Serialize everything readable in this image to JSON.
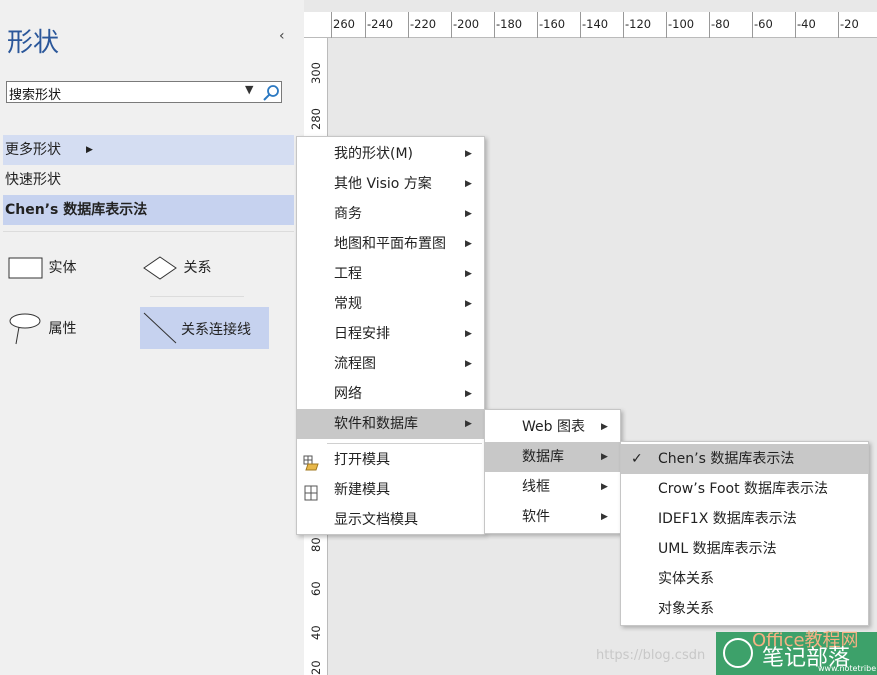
{
  "pane": {
    "title": "形状",
    "collapse_glyph": "‹",
    "search_value": "搜索形状",
    "rows": {
      "more": "更多形状",
      "quick": "快速形状",
      "chen": "Chen’s 数据库表示法"
    },
    "stencils": {
      "entity": "实体",
      "relation": "关系",
      "attribute": "属性",
      "connector": "关系连接线"
    }
  },
  "ruler": {
    "top": [
      "260",
      "-240",
      "-220",
      "-200",
      "-180",
      "-160",
      "-140",
      "-120",
      "-100",
      "-80",
      "-60",
      "-40",
      "-20"
    ],
    "left": [
      "300",
      "280",
      "80",
      "60",
      "40",
      "20"
    ]
  },
  "menu1": {
    "items": [
      "我的形状(M)",
      "其他 Visio 方案",
      "商务",
      "地图和平面布置图",
      "工程",
      "常规",
      "日程安排",
      "流程图",
      "网络",
      "软件和数据库"
    ],
    "actions": [
      "打开模具",
      "新建模具",
      "显示文档模具"
    ]
  },
  "menu2": {
    "items": [
      "Web 图表",
      "数据库",
      "线框",
      "软件"
    ]
  },
  "menu3": {
    "items": [
      "Chen’s 数据库表示法",
      "Crow’s Foot 数据库表示法",
      "IDEF1X 数据库表示法",
      "UML 数据库表示法",
      "实体关系",
      "对象关系"
    ]
  },
  "watermark": {
    "url": "https://blog.csdn",
    "brand": "笔记部落",
    "office": "Office教程网",
    "site": "www.notetribe.com"
  },
  "colors": {
    "title": "#2b579a",
    "highlight": "#c6d2ef",
    "menu_hover": "#c8c8c8",
    "logo": "#2e9a5e"
  }
}
